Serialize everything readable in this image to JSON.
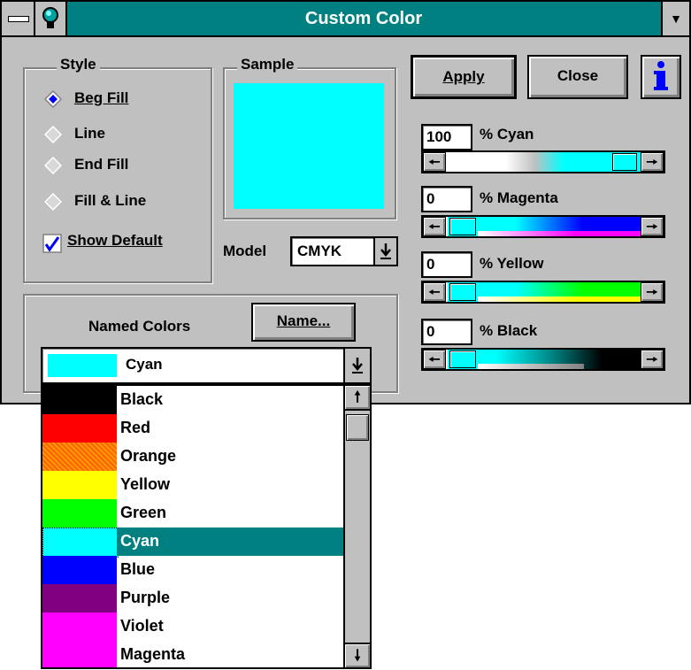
{
  "window": {
    "title": "Custom Color",
    "colors": {
      "titlebar": "#008080",
      "face": "#c0c0c0",
      "selected": "#008080",
      "cyan": "#00ffff"
    }
  },
  "style_group": {
    "label": "Style",
    "options": [
      {
        "label": "Beg Fill",
        "selected": true
      },
      {
        "label": "Line",
        "selected": false
      },
      {
        "label": "End Fill",
        "selected": false
      },
      {
        "label": "Fill & Line",
        "selected": false
      }
    ],
    "show_default": {
      "label": "Show Default",
      "checked": true
    }
  },
  "sample_group": {
    "label": "Sample",
    "color": "#00ffff"
  },
  "model": {
    "label": "Model",
    "value": "CMYK"
  },
  "buttons": {
    "apply": "Apply",
    "close": "Close",
    "info": "i"
  },
  "channels": [
    {
      "value": "100",
      "label": "% Cyan"
    },
    {
      "value": "0",
      "label": "% Magenta"
    },
    {
      "value": "0",
      "label": "% Yellow"
    },
    {
      "value": "0",
      "label": "% Black"
    }
  ],
  "named_colors": {
    "label": "Named Colors",
    "name_button": "Name...",
    "selected": {
      "name": "Cyan",
      "color": "#00ffff"
    },
    "items": [
      {
        "name": "Black",
        "color": "#000000"
      },
      {
        "name": "Red",
        "color": "#ff0000"
      },
      {
        "name": "Orange",
        "color": "#ff8000"
      },
      {
        "name": "Yellow",
        "color": "#ffff00"
      },
      {
        "name": "Green",
        "color": "#00ff00"
      },
      {
        "name": "Cyan",
        "color": "#00ffff",
        "selected": true
      },
      {
        "name": "Blue",
        "color": "#0000ff"
      },
      {
        "name": "Purple",
        "color": "#800080"
      },
      {
        "name": "Violet",
        "color": "#ff00ff"
      },
      {
        "name": "Magenta",
        "color": "#ff00ff"
      }
    ]
  }
}
